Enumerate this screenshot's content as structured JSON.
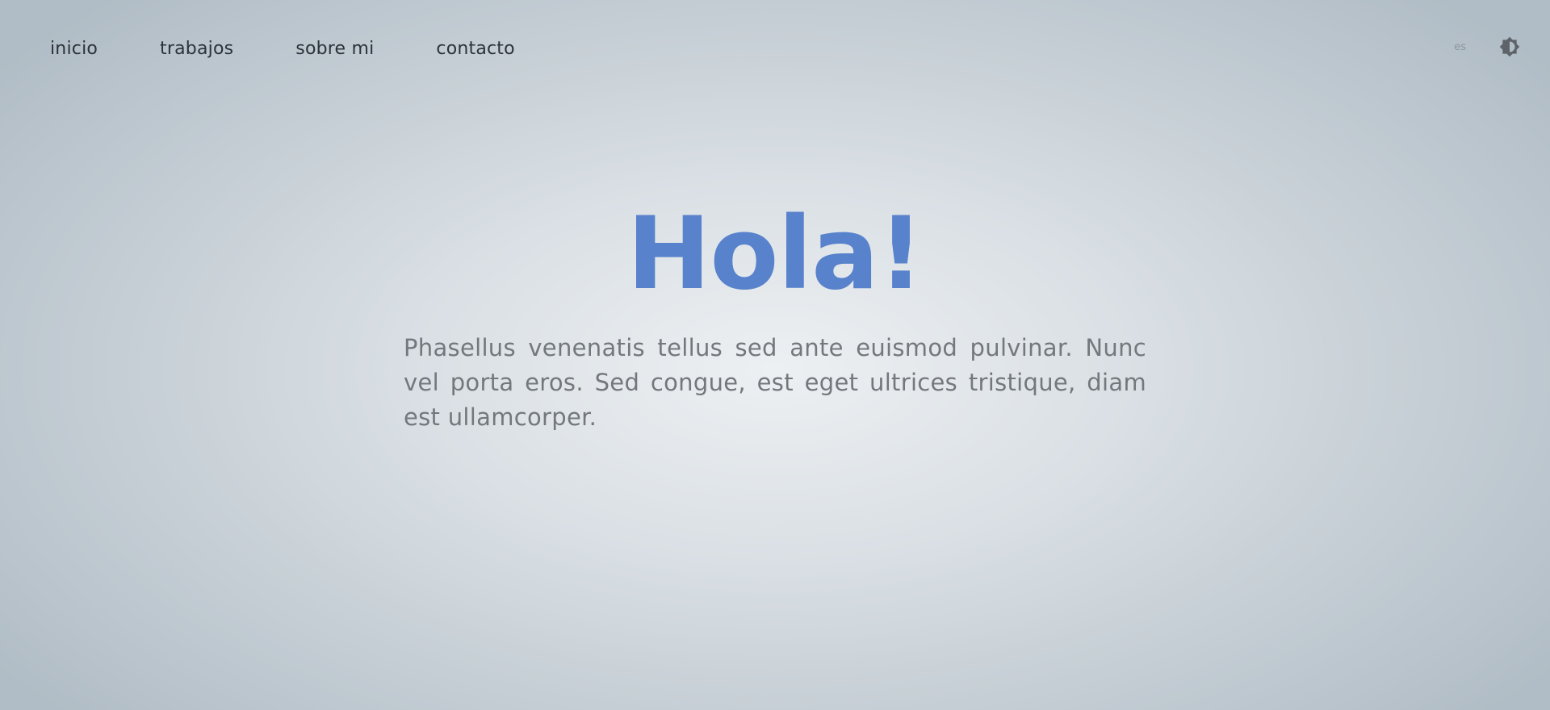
{
  "nav": {
    "items": [
      {
        "label": "inicio"
      },
      {
        "label": "trabajos"
      },
      {
        "label": "sobre mi"
      },
      {
        "label": "contacto"
      }
    ]
  },
  "header": {
    "language": "es",
    "theme_icon": "brightness-icon"
  },
  "hero": {
    "title": "Hola!",
    "text": "Phasellus venenatis tellus sed ante euismod pulvinar. Nunc vel porta eros. Sed congue, est eget ultrices tristique, diam est ullamcorper."
  },
  "colors": {
    "accent": "#5882cc",
    "nav_text": "#2c3239",
    "body_text": "#73787d"
  }
}
